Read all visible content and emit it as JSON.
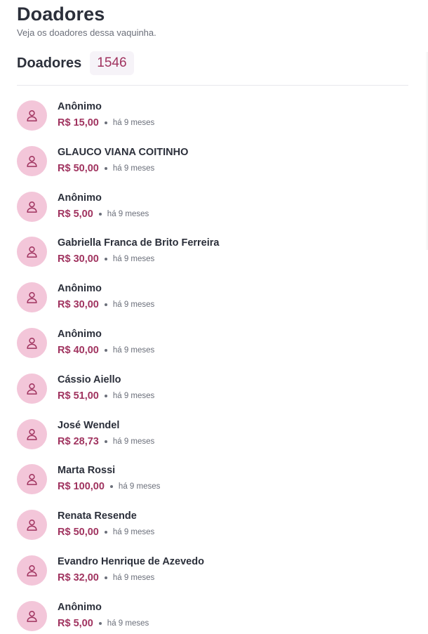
{
  "header": {
    "title": "Doadores",
    "subtitle": "Veja os doadores dessa vaquinha."
  },
  "section": {
    "title": "Doadores",
    "count": "1546"
  },
  "colors": {
    "accent": "#a0335f",
    "avatar_bg": "#f3c6d9",
    "badge_bg": "#f6f3f8"
  },
  "donors": [
    {
      "name": "Anônimo",
      "amount": "R$ 15,00",
      "time": "há 9 meses",
      "icon": "user-icon"
    },
    {
      "name": "GLAUCO VIANA COITINHO",
      "amount": "R$ 50,00",
      "time": "há 9 meses",
      "icon": "user-icon"
    },
    {
      "name": "Anônimo",
      "amount": "R$ 5,00",
      "time": "há 9 meses",
      "icon": "user-icon"
    },
    {
      "name": "Gabriella Franca de Brito Ferreira",
      "amount": "R$ 30,00",
      "time": "há 9 meses",
      "icon": "user-icon"
    },
    {
      "name": "Anônimo",
      "amount": "R$ 30,00",
      "time": "há 9 meses",
      "icon": "user-icon"
    },
    {
      "name": "Anônimo",
      "amount": "R$ 40,00",
      "time": "há 9 meses",
      "icon": "user-icon"
    },
    {
      "name": "Cássio Aiello",
      "amount": "R$ 51,00",
      "time": "há 9 meses",
      "icon": "user-icon"
    },
    {
      "name": "José Wendel",
      "amount": "R$ 28,73",
      "time": "há 9 meses",
      "icon": "user-icon"
    },
    {
      "name": "Marta Rossi",
      "amount": "R$ 100,00",
      "time": "há 9 meses",
      "icon": "user-icon"
    },
    {
      "name": "Renata Resende",
      "amount": "R$ 50,00",
      "time": "há 9 meses",
      "icon": "user-icon"
    },
    {
      "name": "Evandro Henrique de Azevedo",
      "amount": "R$ 32,00",
      "time": "há 9 meses",
      "icon": "user-icon"
    },
    {
      "name": "Anônimo",
      "amount": "R$ 5,00",
      "time": "há 9 meses",
      "icon": "user-icon"
    }
  ]
}
